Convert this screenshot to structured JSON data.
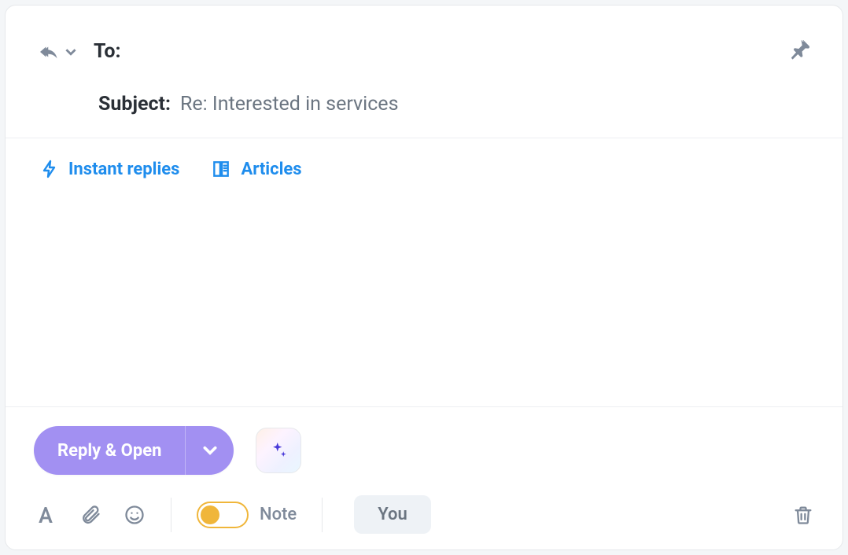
{
  "header": {
    "to_label": "To:",
    "subject_label": "Subject:",
    "subject_value": "Re: Interested in services"
  },
  "quick_actions": {
    "instant_replies": "Instant replies",
    "articles": "Articles"
  },
  "footer": {
    "reply_open": "Reply & Open",
    "note_label": "Note",
    "you_label": "You",
    "note_toggle_on": false
  }
}
